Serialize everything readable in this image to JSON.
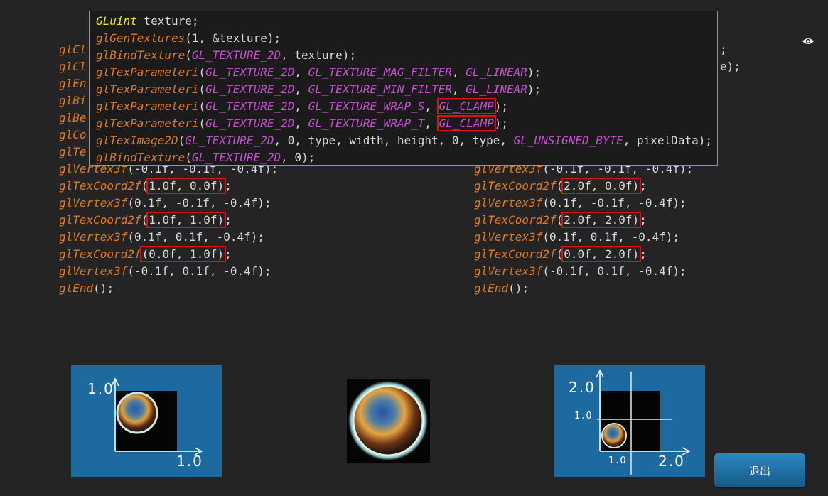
{
  "tooltip": {
    "lines": [
      [
        {
          "t": "GLuint",
          "c": "ty"
        },
        {
          "t": " texture;",
          "c": "tx"
        }
      ],
      [
        {
          "t": "glGenTextures",
          "c": "fn"
        },
        {
          "t": "(1, &texture);",
          "c": "tx"
        }
      ],
      [
        {
          "t": "glBindTexture",
          "c": "fn"
        },
        {
          "t": "(",
          "c": "tx"
        },
        {
          "t": "GL_TEXTURE_2D",
          "c": "cn"
        },
        {
          "t": ", texture);",
          "c": "tx"
        }
      ],
      [
        {
          "t": "glTexParameteri",
          "c": "fn"
        },
        {
          "t": "(",
          "c": "tx"
        },
        {
          "t": "GL_TEXTURE_2D",
          "c": "cn"
        },
        {
          "t": ", ",
          "c": "tx"
        },
        {
          "t": "GL_TEXTURE_MAG_FILTER",
          "c": "cn"
        },
        {
          "t": ", ",
          "c": "tx"
        },
        {
          "t": "GL_LINEAR",
          "c": "cn"
        },
        {
          "t": ");",
          "c": "tx"
        }
      ],
      [
        {
          "t": "glTexParameteri",
          "c": "fn"
        },
        {
          "t": "(",
          "c": "tx"
        },
        {
          "t": "GL_TEXTURE_2D",
          "c": "cn"
        },
        {
          "t": ", ",
          "c": "tx"
        },
        {
          "t": "GL_TEXTURE_MIN_FILTER",
          "c": "cn"
        },
        {
          "t": ", ",
          "c": "tx"
        },
        {
          "t": "GL_LINEAR",
          "c": "cn"
        },
        {
          "t": ");",
          "c": "tx"
        }
      ],
      [
        {
          "t": "glTexParameteri",
          "c": "fn"
        },
        {
          "t": "(",
          "c": "tx"
        },
        {
          "t": "GL_TEXTURE_2D",
          "c": "cn"
        },
        {
          "t": ", ",
          "c": "tx"
        },
        {
          "t": "GL_TEXTURE_WRAP_S",
          "c": "cn"
        },
        {
          "t": ", ",
          "c": "tx"
        },
        {
          "t": "GL_CLAMP",
          "c": "cn",
          "box": true,
          "tail": ");"
        }
      ],
      [
        {
          "t": "glTexParameteri",
          "c": "fn"
        },
        {
          "t": "(",
          "c": "tx"
        },
        {
          "t": "GL_TEXTURE_2D",
          "c": "cn"
        },
        {
          "t": ", ",
          "c": "tx"
        },
        {
          "t": "GL_TEXTURE_WRAP_T",
          "c": "cn"
        },
        {
          "t": ", ",
          "c": "tx"
        },
        {
          "t": "GL_CLAMP",
          "c": "cn",
          "box": true,
          "tail": ");"
        }
      ],
      [
        {
          "t": "glTexImage2D",
          "c": "fn"
        },
        {
          "t": "(",
          "c": "tx"
        },
        {
          "t": "GL_TEXTURE_2D",
          "c": "cn"
        },
        {
          "t": ", 0, type, width, height, 0, type, ",
          "c": "tx"
        },
        {
          "t": "GL_UNSIGNED_BYTE",
          "c": "cn"
        },
        {
          "t": ", pixelData);",
          "c": "tx"
        }
      ],
      [
        {
          "t": "glBindTexture",
          "c": "fn"
        },
        {
          "t": "(",
          "c": "tx"
        },
        {
          "t": "GL_TEXTURE_2D",
          "c": "cn"
        },
        {
          "t": ", 0);",
          "c": "tx"
        }
      ]
    ]
  },
  "left_code": {
    "partial_prefixes": [
      "glCl",
      "glCl",
      "glEn",
      "glBi",
      "glBe",
      "glCo",
      "glTe"
    ],
    "lines": [
      [
        {
          "t": "glVertex3f",
          "c": "fn"
        },
        {
          "t": "(-0.1f, -0.1f, -0.4f);",
          "c": "tx"
        }
      ],
      [
        {
          "t": "glTexCoord2f",
          "c": "fn"
        },
        {
          "t": "1.0f, 0.0f)",
          "c": "tx",
          "box": true,
          "pre": "(",
          "tail": ";"
        }
      ],
      [
        {
          "t": "glVertex3f",
          "c": "fn"
        },
        {
          "t": "(0.1f, -0.1f, -0.4f);",
          "c": "tx"
        }
      ],
      [
        {
          "t": "glTexCoord2f",
          "c": "fn"
        },
        {
          "t": "1.0f, 1.0f)",
          "c": "tx",
          "box": true,
          "pre": "(",
          "tail": ";"
        }
      ],
      [
        {
          "t": "glVertex3f",
          "c": "fn"
        },
        {
          "t": "(0.1f, 0.1f, -0.4f);",
          "c": "tx"
        }
      ],
      [
        {
          "t": "glTexCoord2f",
          "c": "fn"
        },
        {
          "t": "(0.0f, 1.0f)",
          "c": "tx",
          "box": true,
          "tail": ";"
        }
      ],
      [
        {
          "t": "glVertex3f",
          "c": "fn"
        },
        {
          "t": "(-0.1f, 0.1f, -0.4f);",
          "c": "tx"
        }
      ],
      [
        {
          "t": "glEnd",
          "c": "fn"
        },
        {
          "t": "();",
          "c": "tx"
        }
      ]
    ]
  },
  "right_code": {
    "partial_suffixes": [
      ";",
      "",
      "",
      "e);"
    ],
    "lines": [
      [
        {
          "t": "glVertex3f",
          "c": "fn"
        },
        {
          "t": "(-0.1f, -0.1f, -0.4f);",
          "c": "tx"
        }
      ],
      [
        {
          "t": "glTexCoord2f",
          "c": "fn"
        },
        {
          "t": "2.0f, 0.0f)",
          "c": "tx",
          "box": true,
          "pre": "(",
          "tail": ";"
        }
      ],
      [
        {
          "t": "glVertex3f",
          "c": "fn"
        },
        {
          "t": "(0.1f, -0.1f, -0.4f);",
          "c": "tx"
        }
      ],
      [
        {
          "t": "glTexCoord2f",
          "c": "fn"
        },
        {
          "t": "2.0f, 2.0f)",
          "c": "tx",
          "box": true,
          "pre": "(",
          "tail": ";"
        }
      ],
      [
        {
          "t": "glVertex3f",
          "c": "fn"
        },
        {
          "t": "(0.1f, 0.1f, -0.4f);",
          "c": "tx"
        }
      ],
      [
        {
          "t": "glTexCoord2f",
          "c": "fn"
        },
        {
          "t": "0.0f, 2.0f)",
          "c": "tx",
          "box": true,
          "pre": "(",
          "tail": ";"
        }
      ],
      [
        {
          "t": "glVertex3f",
          "c": "fn"
        },
        {
          "t": "(-0.1f, 0.1f, -0.4f);",
          "c": "tx"
        }
      ],
      [
        {
          "t": "glEnd",
          "c": "fn"
        },
        {
          "t": "();",
          "c": "tx"
        }
      ]
    ]
  },
  "diagram_left": {
    "y_label": "1.0",
    "x_label": "1.0"
  },
  "diagram_right": {
    "y_label_big": "2.0",
    "y_label_small": "1.0",
    "x_label_small": "1.0",
    "x_label_big": "2.0"
  },
  "eye_icon": "eye-icon",
  "exit_button": {
    "label": "退出"
  }
}
